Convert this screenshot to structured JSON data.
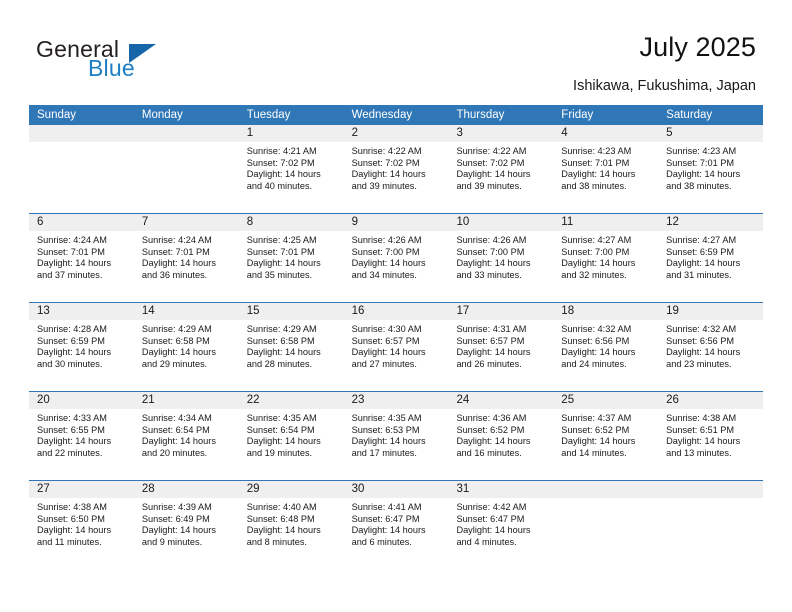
{
  "brand": {
    "name_top": "General",
    "name_bottom": "Blue",
    "triangle_icon": "triangle-logo-icon",
    "accent_color": "#1f7fc4",
    "header_color": "#3077b7"
  },
  "header": {
    "title": "July 2025",
    "subtitle": "Ishikawa, Fukushima, Japan"
  },
  "calendar": {
    "weekdays": [
      "Sunday",
      "Monday",
      "Tuesday",
      "Wednesday",
      "Thursday",
      "Friday",
      "Saturday"
    ],
    "weeks": [
      [
        {
          "day": "",
          "lines": []
        },
        {
          "day": "",
          "lines": []
        },
        {
          "day": "1",
          "lines": [
            "Sunrise: 4:21 AM",
            "Sunset: 7:02 PM",
            "Daylight: 14 hours",
            "and 40 minutes."
          ]
        },
        {
          "day": "2",
          "lines": [
            "Sunrise: 4:22 AM",
            "Sunset: 7:02 PM",
            "Daylight: 14 hours",
            "and 39 minutes."
          ]
        },
        {
          "day": "3",
          "lines": [
            "Sunrise: 4:22 AM",
            "Sunset: 7:02 PM",
            "Daylight: 14 hours",
            "and 39 minutes."
          ]
        },
        {
          "day": "4",
          "lines": [
            "Sunrise: 4:23 AM",
            "Sunset: 7:01 PM",
            "Daylight: 14 hours",
            "and 38 minutes."
          ]
        },
        {
          "day": "5",
          "lines": [
            "Sunrise: 4:23 AM",
            "Sunset: 7:01 PM",
            "Daylight: 14 hours",
            "and 38 minutes."
          ]
        }
      ],
      [
        {
          "day": "6",
          "lines": [
            "Sunrise: 4:24 AM",
            "Sunset: 7:01 PM",
            "Daylight: 14 hours",
            "and 37 minutes."
          ]
        },
        {
          "day": "7",
          "lines": [
            "Sunrise: 4:24 AM",
            "Sunset: 7:01 PM",
            "Daylight: 14 hours",
            "and 36 minutes."
          ]
        },
        {
          "day": "8",
          "lines": [
            "Sunrise: 4:25 AM",
            "Sunset: 7:01 PM",
            "Daylight: 14 hours",
            "and 35 minutes."
          ]
        },
        {
          "day": "9",
          "lines": [
            "Sunrise: 4:26 AM",
            "Sunset: 7:00 PM",
            "Daylight: 14 hours",
            "and 34 minutes."
          ]
        },
        {
          "day": "10",
          "lines": [
            "Sunrise: 4:26 AM",
            "Sunset: 7:00 PM",
            "Daylight: 14 hours",
            "and 33 minutes."
          ]
        },
        {
          "day": "11",
          "lines": [
            "Sunrise: 4:27 AM",
            "Sunset: 7:00 PM",
            "Daylight: 14 hours",
            "and 32 minutes."
          ]
        },
        {
          "day": "12",
          "lines": [
            "Sunrise: 4:27 AM",
            "Sunset: 6:59 PM",
            "Daylight: 14 hours",
            "and 31 minutes."
          ]
        }
      ],
      [
        {
          "day": "13",
          "lines": [
            "Sunrise: 4:28 AM",
            "Sunset: 6:59 PM",
            "Daylight: 14 hours",
            "and 30 minutes."
          ]
        },
        {
          "day": "14",
          "lines": [
            "Sunrise: 4:29 AM",
            "Sunset: 6:58 PM",
            "Daylight: 14 hours",
            "and 29 minutes."
          ]
        },
        {
          "day": "15",
          "lines": [
            "Sunrise: 4:29 AM",
            "Sunset: 6:58 PM",
            "Daylight: 14 hours",
            "and 28 minutes."
          ]
        },
        {
          "day": "16",
          "lines": [
            "Sunrise: 4:30 AM",
            "Sunset: 6:57 PM",
            "Daylight: 14 hours",
            "and 27 minutes."
          ]
        },
        {
          "day": "17",
          "lines": [
            "Sunrise: 4:31 AM",
            "Sunset: 6:57 PM",
            "Daylight: 14 hours",
            "and 26 minutes."
          ]
        },
        {
          "day": "18",
          "lines": [
            "Sunrise: 4:32 AM",
            "Sunset: 6:56 PM",
            "Daylight: 14 hours",
            "and 24 minutes."
          ]
        },
        {
          "day": "19",
          "lines": [
            "Sunrise: 4:32 AM",
            "Sunset: 6:56 PM",
            "Daylight: 14 hours",
            "and 23 minutes."
          ]
        }
      ],
      [
        {
          "day": "20",
          "lines": [
            "Sunrise: 4:33 AM",
            "Sunset: 6:55 PM",
            "Daylight: 14 hours",
            "and 22 minutes."
          ]
        },
        {
          "day": "21",
          "lines": [
            "Sunrise: 4:34 AM",
            "Sunset: 6:54 PM",
            "Daylight: 14 hours",
            "and 20 minutes."
          ]
        },
        {
          "day": "22",
          "lines": [
            "Sunrise: 4:35 AM",
            "Sunset: 6:54 PM",
            "Daylight: 14 hours",
            "and 19 minutes."
          ]
        },
        {
          "day": "23",
          "lines": [
            "Sunrise: 4:35 AM",
            "Sunset: 6:53 PM",
            "Daylight: 14 hours",
            "and 17 minutes."
          ]
        },
        {
          "day": "24",
          "lines": [
            "Sunrise: 4:36 AM",
            "Sunset: 6:52 PM",
            "Daylight: 14 hours",
            "and 16 minutes."
          ]
        },
        {
          "day": "25",
          "lines": [
            "Sunrise: 4:37 AM",
            "Sunset: 6:52 PM",
            "Daylight: 14 hours",
            "and 14 minutes."
          ]
        },
        {
          "day": "26",
          "lines": [
            "Sunrise: 4:38 AM",
            "Sunset: 6:51 PM",
            "Daylight: 14 hours",
            "and 13 minutes."
          ]
        }
      ],
      [
        {
          "day": "27",
          "lines": [
            "Sunrise: 4:38 AM",
            "Sunset: 6:50 PM",
            "Daylight: 14 hours",
            "and 11 minutes."
          ]
        },
        {
          "day": "28",
          "lines": [
            "Sunrise: 4:39 AM",
            "Sunset: 6:49 PM",
            "Daylight: 14 hours",
            "and 9 minutes."
          ]
        },
        {
          "day": "29",
          "lines": [
            "Sunrise: 4:40 AM",
            "Sunset: 6:48 PM",
            "Daylight: 14 hours",
            "and 8 minutes."
          ]
        },
        {
          "day": "30",
          "lines": [
            "Sunrise: 4:41 AM",
            "Sunset: 6:47 PM",
            "Daylight: 14 hours",
            "and 6 minutes."
          ]
        },
        {
          "day": "31",
          "lines": [
            "Sunrise: 4:42 AM",
            "Sunset: 6:47 PM",
            "Daylight: 14 hours",
            "and 4 minutes."
          ]
        },
        {
          "day": "",
          "lines": []
        },
        {
          "day": "",
          "lines": []
        }
      ]
    ]
  }
}
